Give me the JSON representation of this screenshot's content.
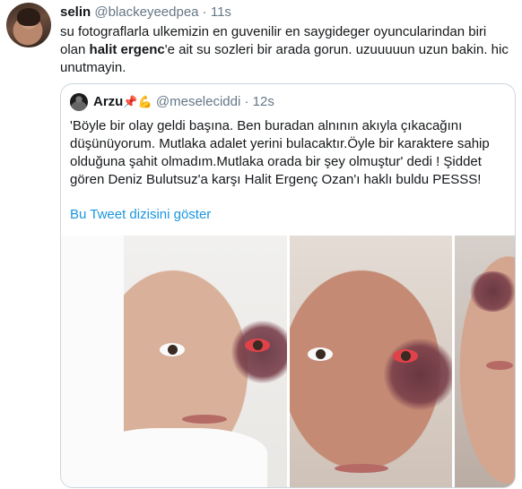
{
  "tweet": {
    "name": "selin",
    "handle": "@blackeyeedpea",
    "dot": "·",
    "time": "11s",
    "text_part1": "su fotograflarla ulkemizin en guvenilir en saygideger oyuncularindan biri olan ",
    "text_bold": "halit ergenc",
    "text_part2": "'e ait su sozleri bir arada gorun. uzuuuuun uzun bakin. hic unutmayin."
  },
  "quoted_tweet": {
    "name": "Arzu",
    "name_emoji": "📌💪",
    "handle": "@meseleciddi",
    "dot": "·",
    "time": "12s",
    "text": "'Böyle bir olay geldi başına. Ben buradan alnının akıyla çıkacağını düşünüyorum. Mutlaka adalet yerini bulacaktır.Öyle bir karaktere sahip olduğuna şahit olmadım.Mutlaka orada bir şey olmuştur' dedi ! Şiddet gören Deniz Bulutsuz'a karşı Halit Ergenç Ozan'ı haklı buldu PESSS!",
    "thread_link": "Bu Tweet dizisini göster",
    "photos": [
      "photo-1",
      "photo-2",
      "photo-3"
    ]
  },
  "colors": {
    "text_primary": "#14171a",
    "text_secondary": "#657786",
    "link": "#1b95e0",
    "border": "#ccd6dd"
  }
}
